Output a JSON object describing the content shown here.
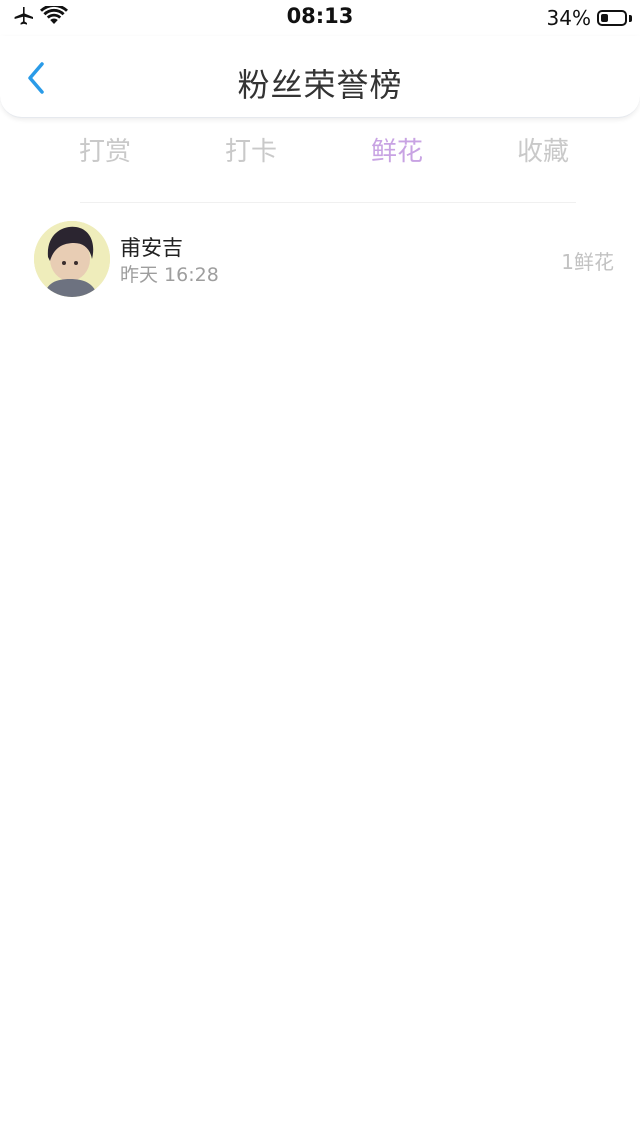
{
  "status_bar": {
    "time": "08:13",
    "battery_text": "34%",
    "battery_level": 0.34,
    "icons": [
      "airplane-icon",
      "wifi-icon",
      "battery-icon"
    ]
  },
  "header": {
    "title": "粉丝荣誉榜",
    "back_icon": "chevron-left-icon",
    "back_color": "#2a9be8"
  },
  "tabs": [
    {
      "label": "打赏",
      "active": false
    },
    {
      "label": "打卡",
      "active": false
    },
    {
      "label": "鲜花",
      "active": true
    },
    {
      "label": "收藏",
      "active": false
    }
  ],
  "colors": {
    "tab_active": "#c8a3e3",
    "tab_inactive": "#c9c9c9"
  },
  "fans": [
    {
      "name": "甫安吉",
      "time": "昨天 16:28",
      "amount": "1鲜花",
      "avatar": "user-avatar"
    }
  ]
}
